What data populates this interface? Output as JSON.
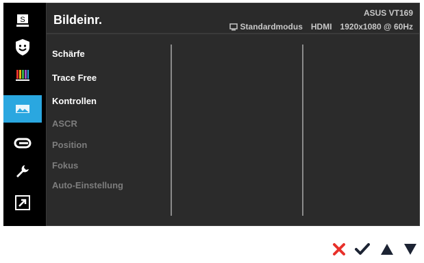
{
  "header": {
    "title": "Bildeinr.",
    "model": "ASUS VT169",
    "status": {
      "mode": "Standardmodus",
      "input": "HDMI",
      "resolution": "1920x1080 @ 60Hz"
    }
  },
  "sidebar": {
    "items": [
      {
        "name": "splendid",
        "icon": "splendid-s-icon",
        "label": "S",
        "active": false
      },
      {
        "name": "blue-light-filter",
        "icon": "blue-light-filter-icon",
        "active": false
      },
      {
        "name": "color",
        "icon": "color-bars-icon",
        "active": false
      },
      {
        "name": "image",
        "icon": "image-icon",
        "active": true
      },
      {
        "name": "input-select",
        "icon": "input-select-icon",
        "active": false
      },
      {
        "name": "system-setup",
        "icon": "wrench-icon",
        "active": false
      },
      {
        "name": "shortcut",
        "icon": "shortcut-arrow-icon",
        "active": false
      }
    ]
  },
  "menu": {
    "items": [
      {
        "label": "Schärfe",
        "enabled": true
      },
      {
        "label": "Trace Free",
        "enabled": true
      },
      {
        "label": "Kontrollen",
        "enabled": true
      },
      {
        "label": "ASCR",
        "enabled": false
      },
      {
        "label": "Position",
        "enabled": false
      },
      {
        "label": "Fokus",
        "enabled": false
      },
      {
        "label": "Auto-Einstellung",
        "enabled": false
      }
    ]
  },
  "buttons": [
    {
      "name": "exit-button",
      "icon": "close-icon",
      "color": "#e8312b"
    },
    {
      "name": "confirm-button",
      "icon": "checkmark-icon",
      "color": "#1c2333"
    },
    {
      "name": "up-button",
      "icon": "triangle-up-icon",
      "color": "#1c2333"
    },
    {
      "name": "down-button",
      "icon": "triangle-down-icon",
      "color": "#1c2333"
    }
  ],
  "colors": {
    "accent": "#2aa7e0",
    "background": "#000000",
    "panel": "#2b2b2b",
    "text_enabled": "#ffffff",
    "text_disabled": "#7d7d7d"
  }
}
